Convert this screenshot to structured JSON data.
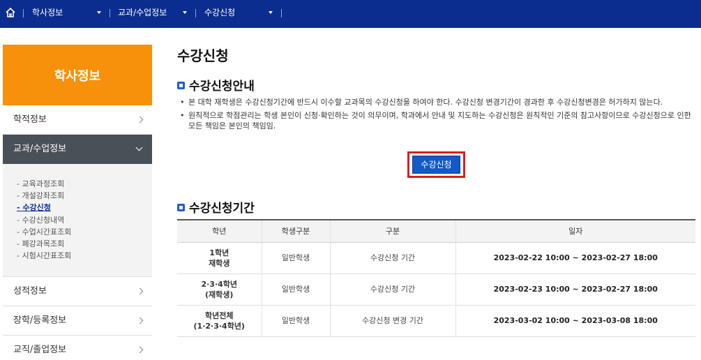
{
  "topnav": {
    "home_icon": "home-icon",
    "menus": [
      "학사정보",
      "교과/수업정보",
      "수강신청"
    ]
  },
  "sidebar": {
    "header": "학사정보",
    "items": [
      {
        "label": "학적정보"
      },
      {
        "label": "교과/수업정보",
        "active": true
      },
      {
        "label": "성적정보"
      },
      {
        "label": "장학/등록정보"
      },
      {
        "label": "교직/졸업정보"
      }
    ],
    "submenu": [
      "- 교육과정조회",
      "- 개설강좌조회",
      "- 수강신청",
      "- 수강신청내역",
      "- 수업시간표조회",
      "- 폐강과목조회",
      "- 시험시간표조회"
    ],
    "submenu_active": "- 수강신청",
    "header_color": "#f7900a",
    "active_color": "#4a5057"
  },
  "main": {
    "title": "수강신청",
    "guide_title": "수강신청안내",
    "notes": [
      "본 대학 재학생은 수강신청기간에 반드시 이수할 교과목의 수강신청을 하여야 한다. 수강신청 변경기간이 경과한 후 수강신청변경은 허가하지 않는다.",
      "원칙적으로 학점관리는 학생 본인이 신청·확인하는 것이 의무이며, 학과에서 안내 및 지도하는 수강신청은 원칙적인 기준의 참고사항이므로 수강신청으로 인한 모든 책임은 본인의 책임임."
    ],
    "apply_button": "수강신청",
    "period_title": "수강신청기간",
    "table": {
      "headers": [
        "학년",
        "학생구분",
        "구분",
        "일자"
      ],
      "rows": [
        {
          "grade": [
            "1학년",
            "재학생"
          ],
          "type": "일반학생",
          "kind": "수강신청 기간",
          "date": "2023-02-22 10:00 ~ 2023-02-27 18:00"
        },
        {
          "grade": [
            "2·3·4학년",
            "(재학생)"
          ],
          "type": "일반학생",
          "kind": "수강신청 기간",
          "date": "2023-02-23 10:00 ~ 2023-02-27 18:00"
        },
        {
          "grade": [
            "학년전체",
            "(1·2·3·4학년)"
          ],
          "type": "일반학생",
          "kind": "수강신청 변경 기간",
          "date": "2023-03-02 10:00 ~ 2023-03-08 18:00"
        }
      ]
    }
  },
  "colors": {
    "nav": "#0b2d8f",
    "button": "#1259c9",
    "highlight": "#e01b1b",
    "bullet": "#1f5bd6"
  }
}
